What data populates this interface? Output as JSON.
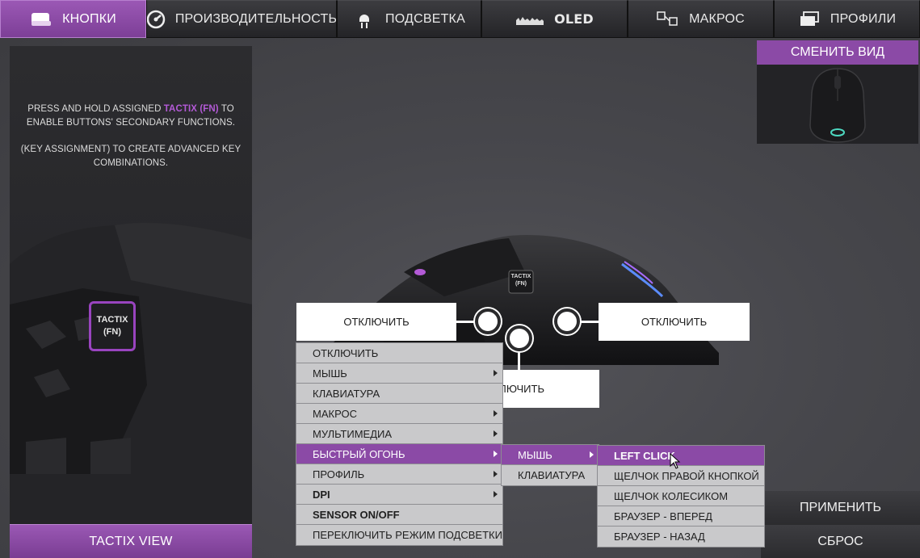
{
  "tabs": [
    {
      "label": "КНОПКИ",
      "icon": "keyboard-icon",
      "active": true
    },
    {
      "label": "ПРОИЗВОДИТЕЛЬНОСТЬ",
      "icon": "gauge-icon",
      "active": false
    },
    {
      "label": "ПОДСВЕТКА",
      "icon": "led-icon",
      "active": false
    },
    {
      "label": "OLED",
      "icon": "oled-icon",
      "active": false
    },
    {
      "label": "МАКРОС",
      "icon": "macro-icon",
      "active": false
    },
    {
      "label": "ПРОФИЛИ",
      "icon": "profiles-icon",
      "active": false
    }
  ],
  "tactix": {
    "line1a": "PRESS AND HOLD ASSIGNED ",
    "line1_highlight": "TACTIX (FN)",
    "line1b": " TO",
    "line2": "ENABLE BUTTONS' SECONDARY FUNCTIONS.",
    "line3": "(KEY ASSIGNMENT) TO CREATE ADVANCED KEY COMBINATIONS.",
    "button_line1": "TACTIX",
    "button_line2": "(FN)",
    "view_button": "TACTIX VIEW"
  },
  "center_mouse": {
    "badge_line1": "TACTIX",
    "badge_line2": "(FN)"
  },
  "switch_view": {
    "label": "СМЕНИТЬ ВИД"
  },
  "callouts": {
    "left": "ОТКЛЮЧИТЬ",
    "right": "ОТКЛЮЧИТЬ",
    "bottom": "ОТКЛЮЧИТЬ"
  },
  "actions": {
    "apply": "ПРИМЕНИТЬ",
    "reset": "СБРОС"
  },
  "menu_main": [
    {
      "label": "ОТКЛЮЧИТЬ",
      "submenu": false
    },
    {
      "label": "МЫШЬ",
      "submenu": true
    },
    {
      "label": "КЛАВИАТУРА",
      "submenu": false
    },
    {
      "label": "МАКРОС",
      "submenu": true
    },
    {
      "label": "МУЛЬТИМЕДИА",
      "submenu": true
    },
    {
      "label": "БЫСТРЫЙ ОГОНЬ",
      "submenu": true,
      "selected": true
    },
    {
      "label": "ПРОФИЛЬ",
      "submenu": true
    },
    {
      "label": "DPI",
      "submenu": true,
      "bold": true
    },
    {
      "label": "SENSOR ON/OFF",
      "submenu": false,
      "bold": true
    },
    {
      "label": "ПЕРЕКЛЮЧИТЬ РЕЖИМ ПОДСВЕТКИ",
      "submenu": false
    }
  ],
  "menu_sub": [
    {
      "label": "МЫШЬ",
      "submenu": true,
      "selected": true
    },
    {
      "label": "КЛАВИАТУРА",
      "submenu": false
    }
  ],
  "menu_sub2": [
    {
      "label": "LEFT CLICK",
      "selected": true,
      "bold": true
    },
    {
      "label": "ЩЕЛЧОК ПРАВОЙ КНОПКОЙ"
    },
    {
      "label": "ЩЕЛЧОК КОЛЕСИКОМ"
    },
    {
      "label": "БРАУЗЕР - ВПЕРЕД"
    },
    {
      "label": "БРАУЗЕР - НАЗАД"
    }
  ],
  "colors": {
    "accent": "#8b4aa6",
    "accent_text": "#b35ad6",
    "menu_bg": "#c9c9cb"
  }
}
